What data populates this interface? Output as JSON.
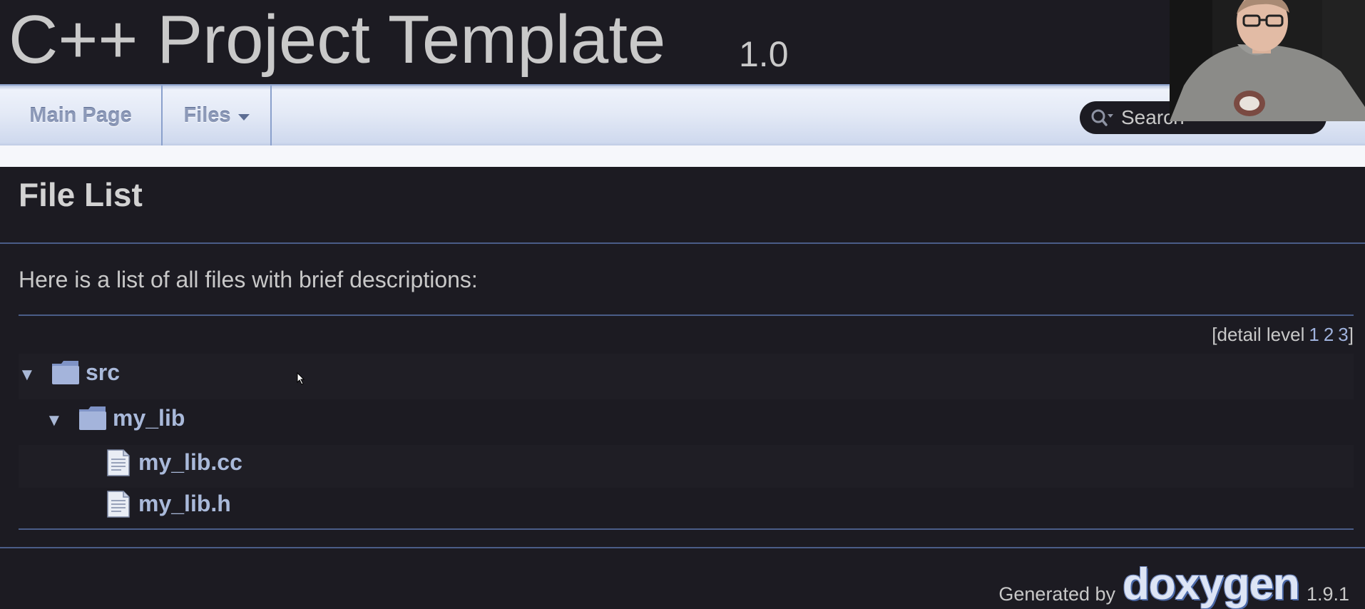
{
  "title_area": {
    "project_name": "C++ Project Template",
    "project_number": "1.0"
  },
  "navbar": {
    "main_page": "Main Page",
    "files": "Files",
    "search_placeholder": "Search"
  },
  "header": {
    "title": "File List"
  },
  "contents": {
    "intro": "Here is a list of all files with brief descriptions:",
    "detail_level": {
      "prefix": "[detail level",
      "levels": [
        "1",
        "2",
        "3"
      ],
      "suffix": "]"
    },
    "tree": [
      {
        "label": "src",
        "type": "folder",
        "expanded": true,
        "arrow": "▼"
      },
      {
        "label": "my_lib",
        "type": "folder",
        "expanded": true,
        "arrow": "▼"
      },
      {
        "label": "my_lib.cc",
        "type": "file"
      },
      {
        "label": "my_lib.h",
        "type": "file"
      }
    ]
  },
  "footer": {
    "generated_by": "Generated by",
    "logo": "doxygen",
    "version": "1.9.1"
  },
  "colors": {
    "background": "#1c1b22",
    "navbar": "#e3e9f6",
    "link": "#a9b9da",
    "rule": "#4a5d88"
  }
}
